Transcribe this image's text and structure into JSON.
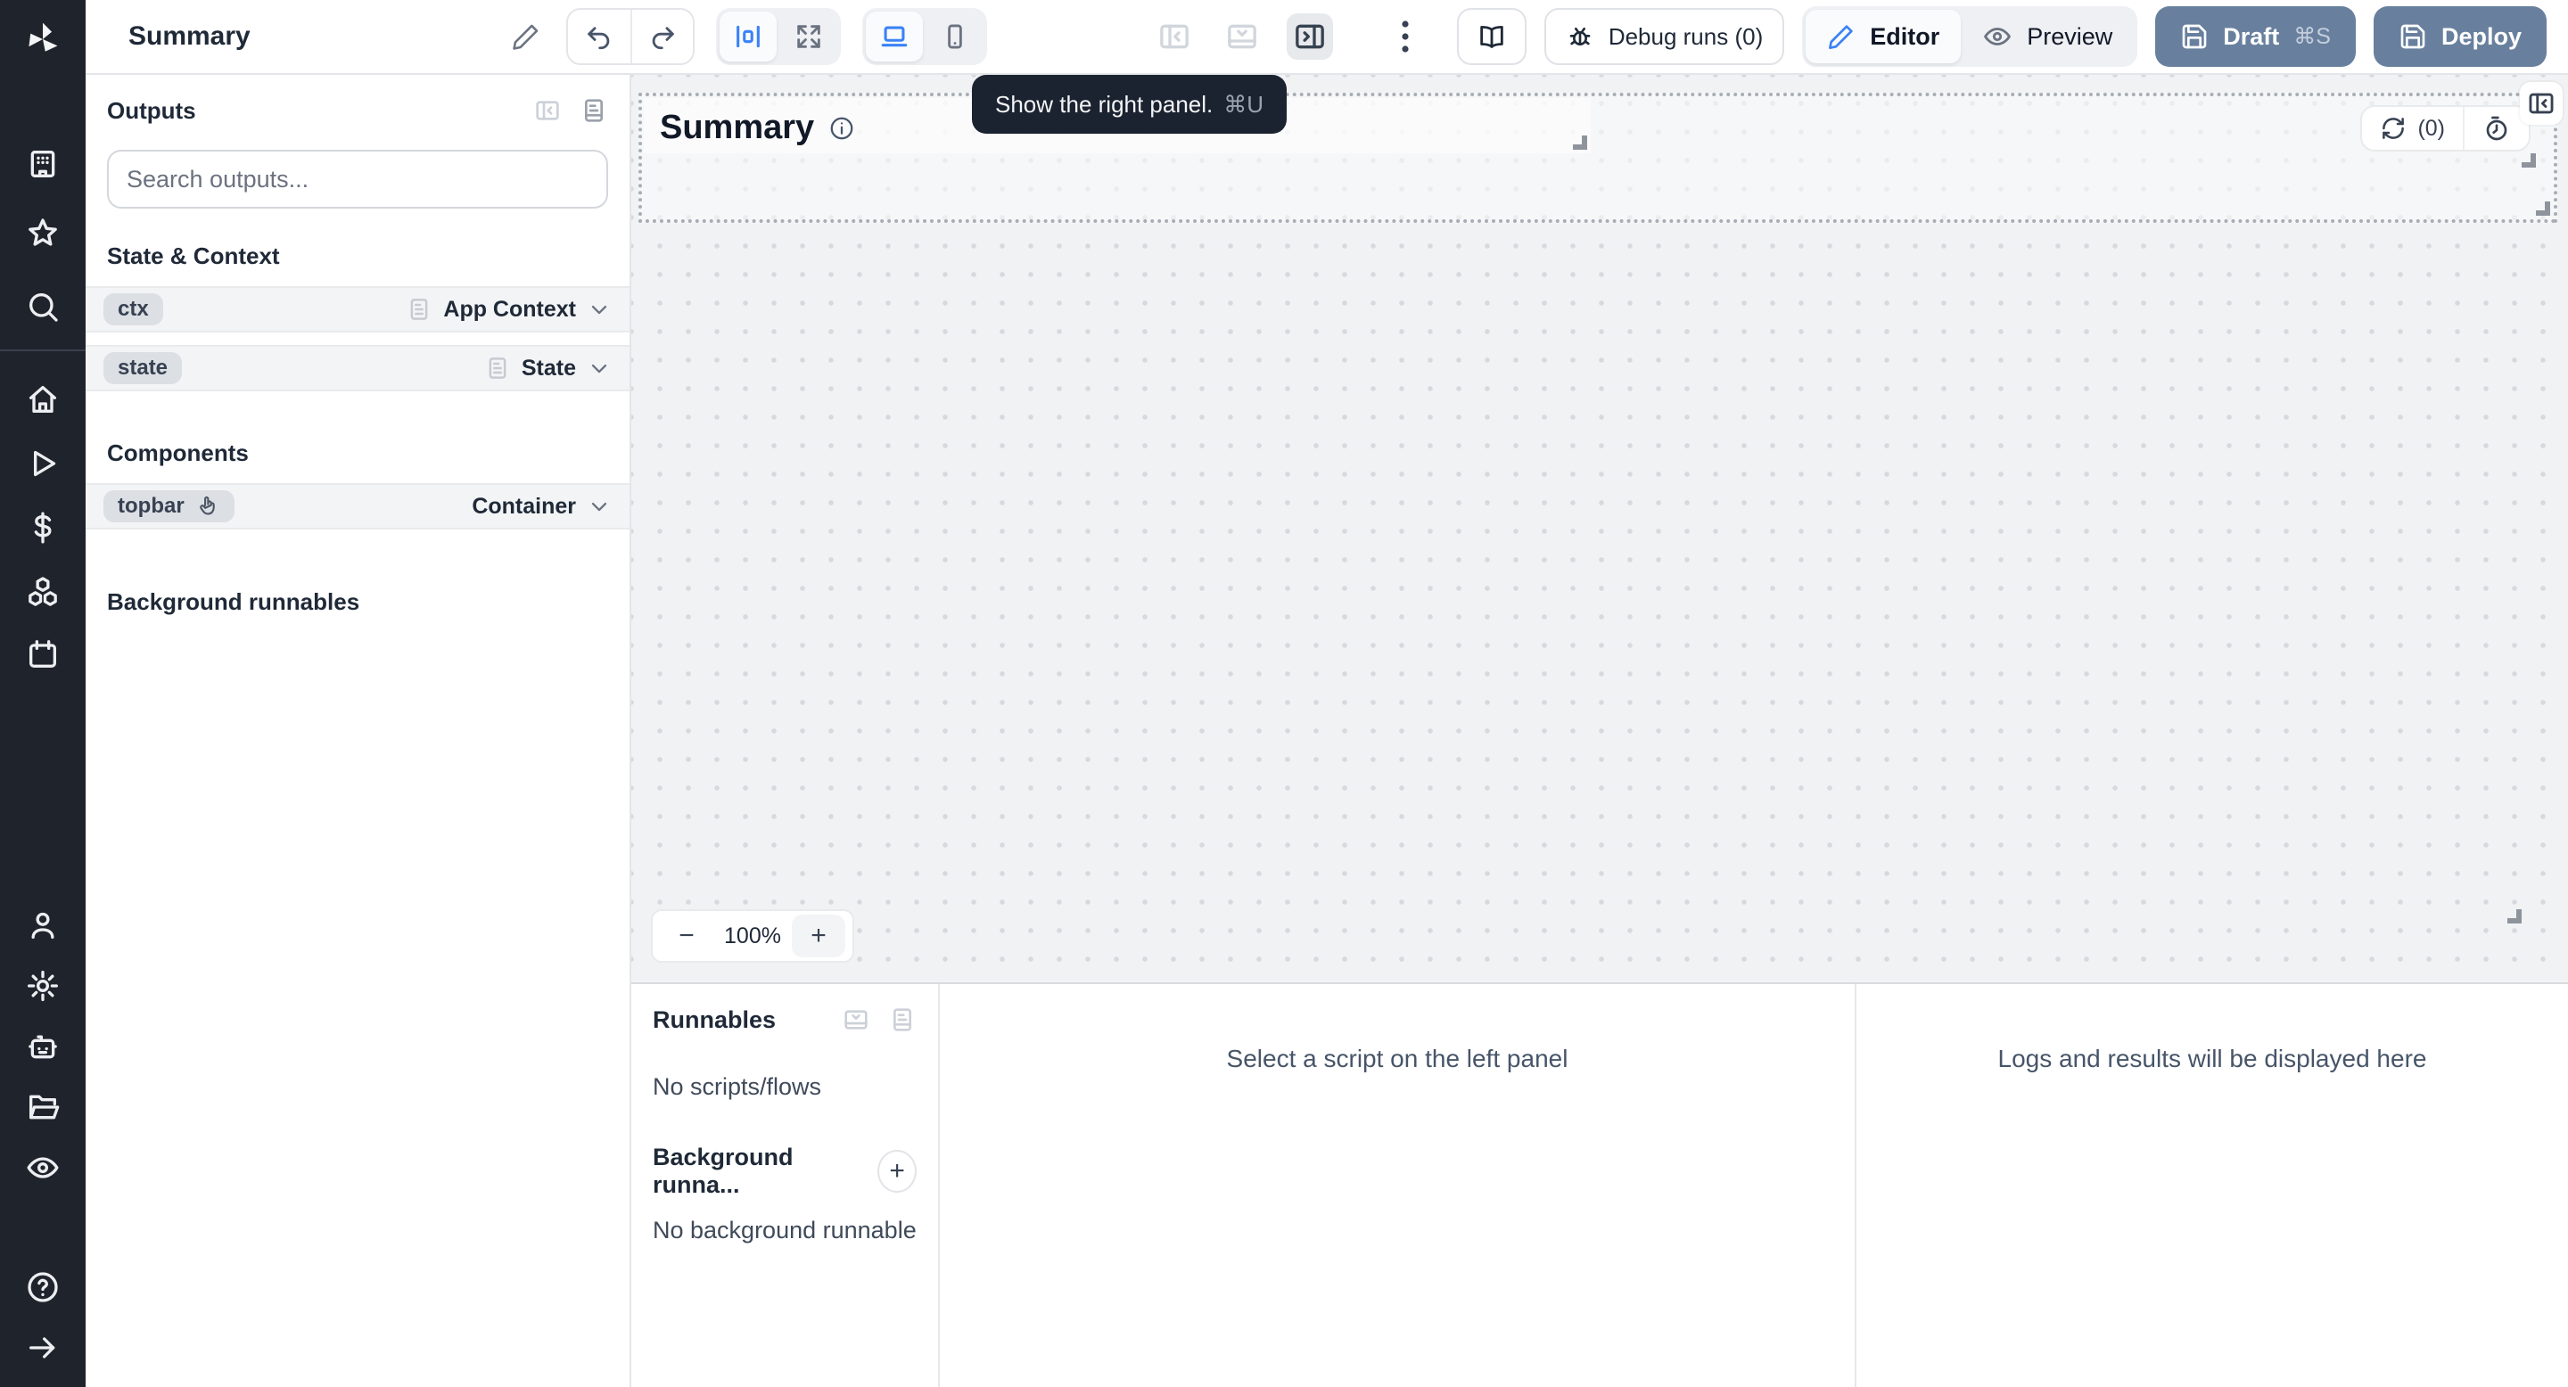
{
  "colors": {
    "accent": "#3b82f6",
    "primary_button": "#68809e",
    "sidebar_bg": "#1f232b",
    "tooltip_bg": "#1c2330"
  },
  "header": {
    "title": "Summary",
    "debug_runs": "Debug runs (0)",
    "editor": "Editor",
    "preview": "Preview",
    "draft": "Draft",
    "draft_shortcut": "⌘S",
    "deploy": "Deploy",
    "tooltip_text": "Show the right panel.",
    "tooltip_shortcut": "⌘U"
  },
  "outputs_panel": {
    "title": "Outputs",
    "search_placeholder": "Search outputs...",
    "state_context_title": "State & Context",
    "components_title": "Components",
    "background_title": "Background runnables",
    "rows": [
      {
        "id": "ctx",
        "type": "App Context"
      },
      {
        "id": "state",
        "type": "State"
      },
      {
        "id": "topbar",
        "type": "Container"
      }
    ]
  },
  "canvas": {
    "component_title": "Summary",
    "refresh_count": "(0)",
    "zoom_out": "−",
    "zoom_level": "100%",
    "zoom_in": "+"
  },
  "runnables_panel": {
    "title": "Runnables",
    "empty_scripts": "No scripts/flows",
    "background_title": "Background runna...",
    "add_button": "+",
    "empty_background": "No background runnable"
  },
  "results_panel": {
    "script_hint": "Select a script on the left panel",
    "logs_hint": "Logs and results will be displayed here"
  }
}
